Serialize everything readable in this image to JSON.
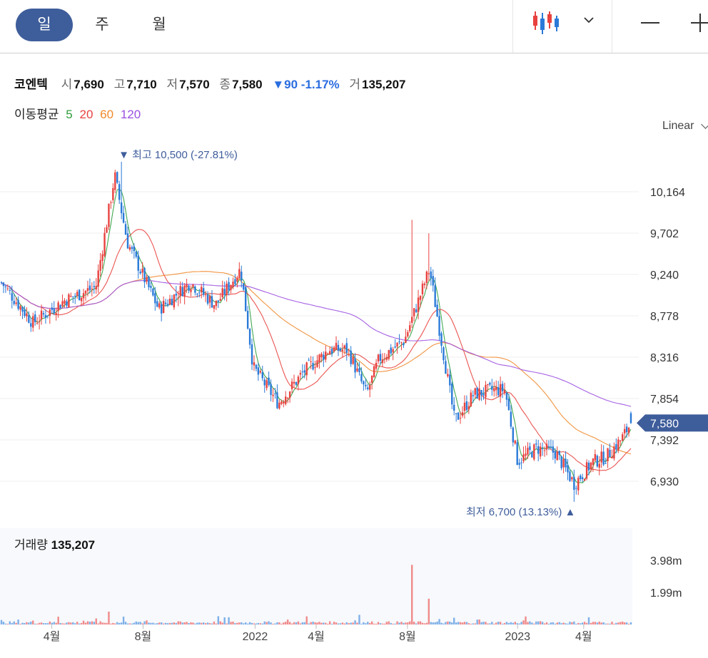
{
  "toolbar": {
    "periods": [
      {
        "label": "일",
        "active": true
      },
      {
        "label": "주",
        "active": false
      },
      {
        "label": "월",
        "active": false
      }
    ],
    "chart_type_icon": "candlestick-icon",
    "dropdown_icon": "chevron-down-icon",
    "zoom_out_icon": "minus-icon",
    "zoom_in_icon": "plus-icon"
  },
  "quote": {
    "name": "코엔텍",
    "open_label": "시",
    "open": "7,690",
    "high_label": "고",
    "high": "7,710",
    "low_label": "저",
    "low": "7,570",
    "close_label": "종",
    "close": "7,580",
    "change": "▼90 -1.17%",
    "volume_label": "거",
    "volume": "135,207"
  },
  "moving_average": {
    "label": "이동평균",
    "periods": [
      {
        "label": "5",
        "color": "#2e9e3e"
      },
      {
        "label": "20",
        "color": "#e8423f"
      },
      {
        "label": "60",
        "color": "#f08a2c"
      },
      {
        "label": "120",
        "color": "#9b4fe0"
      }
    ]
  },
  "scale_mode": "Linear",
  "volume_panel": {
    "label": "거래량",
    "value": "135,207",
    "ticks": [
      "3.98m",
      "1.99m"
    ]
  },
  "colors": {
    "up": "#e8423f",
    "down": "#2a7ad8",
    "accent": "#3e5d9b"
  },
  "chart_data": {
    "type": "candlestick",
    "price_ticks": [
      10164,
      9702,
      9240,
      8778,
      8316,
      7854,
      7392,
      6930
    ],
    "price_tick_labels": [
      "10,164",
      "9,702",
      "9,240",
      "8,778",
      "8,316",
      "7,854",
      "7,392",
      "6,930"
    ],
    "x_tick_labels": [
      "4월",
      "8월",
      "2022",
      "4월",
      "8월",
      "2023",
      "4월"
    ],
    "last_price_label": "7,580",
    "max_annotation": {
      "prefix": "▼ 최고",
      "value": "10,500 (-27.81%)"
    },
    "min_annotation": {
      "prefix": "최저",
      "value": "6,700 (13.13%)",
      "suffix": "▲"
    },
    "anchors": [
      [
        0,
        9150
      ],
      [
        0.05,
        8700
      ],
      [
        0.1,
        8950
      ],
      [
        0.15,
        9100
      ],
      [
        0.18,
        10350
      ],
      [
        0.2,
        9600
      ],
      [
        0.25,
        8850
      ],
      [
        0.3,
        9150
      ],
      [
        0.34,
        8900
      ],
      [
        0.38,
        9300
      ],
      [
        0.4,
        8200
      ],
      [
        0.44,
        7800
      ],
      [
        0.48,
        8150
      ],
      [
        0.52,
        8400
      ],
      [
        0.55,
        8400
      ],
      [
        0.58,
        7900
      ],
      [
        0.6,
        8300
      ],
      [
        0.64,
        8500
      ],
      [
        0.68,
        9300
      ],
      [
        0.72,
        7600
      ],
      [
        0.75,
        7900
      ],
      [
        0.78,
        7950
      ],
      [
        0.8,
        7950
      ],
      [
        0.82,
        7150
      ],
      [
        0.85,
        7300
      ],
      [
        0.88,
        7250
      ],
      [
        0.91,
        6900
      ],
      [
        0.94,
        7150
      ],
      [
        0.96,
        7200
      ],
      [
        0.985,
        7400
      ],
      [
        1,
        7580
      ]
    ],
    "spikes": [
      {
        "pos": 0.192,
        "high": 10500
      },
      {
        "pos": 0.652,
        "high": 9850
      },
      {
        "pos": 0.68,
        "high": 9700
      },
      {
        "pos": 0.91,
        "low": 6700
      }
    ],
    "volume_spikes": [
      {
        "pos": 0.652,
        "value": 3700000
      },
      {
        "pos": 0.68,
        "value": 1600000
      },
      {
        "pos": 0.17,
        "value": 800000
      },
      {
        "pos": 0.36,
        "value": 450000
      },
      {
        "pos": 0.57,
        "value": 600000
      }
    ]
  }
}
